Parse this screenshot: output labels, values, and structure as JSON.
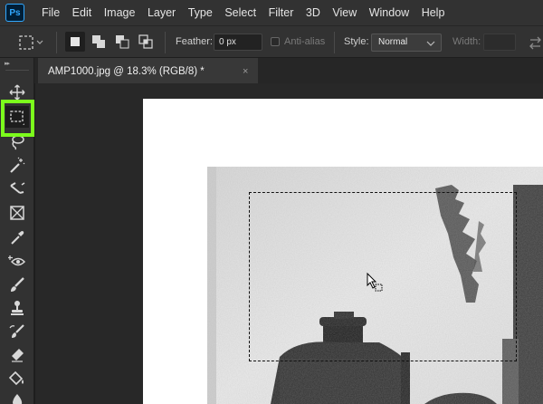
{
  "app": {
    "logo_text": "Ps"
  },
  "menu": [
    "File",
    "Edit",
    "Image",
    "Layer",
    "Type",
    "Select",
    "Filter",
    "3D",
    "View",
    "Window",
    "Help"
  ],
  "options": {
    "feather_label": "Feather:",
    "feather_value": "0 px",
    "antialias_label": "Anti-alias",
    "style_label": "Style:",
    "style_value": "Normal",
    "width_label": "Width:",
    "width_value": ""
  },
  "document_tab": {
    "title": "AMP1000.jpg @ 18.3% (RGB/8) *",
    "close_glyph": "×"
  },
  "tools": [
    {
      "name": "move-tool",
      "icon": "move-icon"
    },
    {
      "name": "rectangular-marquee-tool",
      "icon": "marquee-icon",
      "active": true
    },
    {
      "name": "lasso-tool",
      "icon": "lasso-icon"
    },
    {
      "name": "magic-wand-tool",
      "icon": "magic-wand-icon"
    },
    {
      "name": "crop-tool",
      "icon": "crop-icon"
    },
    {
      "name": "frame-tool",
      "icon": "frame-icon"
    },
    {
      "name": "eyedropper-tool",
      "icon": "eyedropper-icon"
    },
    {
      "name": "red-eye-tool",
      "icon": "red-eye-icon"
    },
    {
      "name": "brush-tool",
      "icon": "brush-icon"
    },
    {
      "name": "clone-stamp-tool",
      "icon": "stamp-icon"
    },
    {
      "name": "history-brush-tool",
      "icon": "history-brush-icon"
    },
    {
      "name": "eraser-tool",
      "icon": "eraser-icon"
    },
    {
      "name": "paint-bucket-tool",
      "icon": "paint-bucket-icon"
    },
    {
      "name": "blur-tool",
      "icon": "blur-icon"
    }
  ],
  "colors": {
    "highlight": "#7cfc1c",
    "ps_blue": "#31a8ff",
    "panel": "#323232",
    "workspace": "#282828"
  }
}
